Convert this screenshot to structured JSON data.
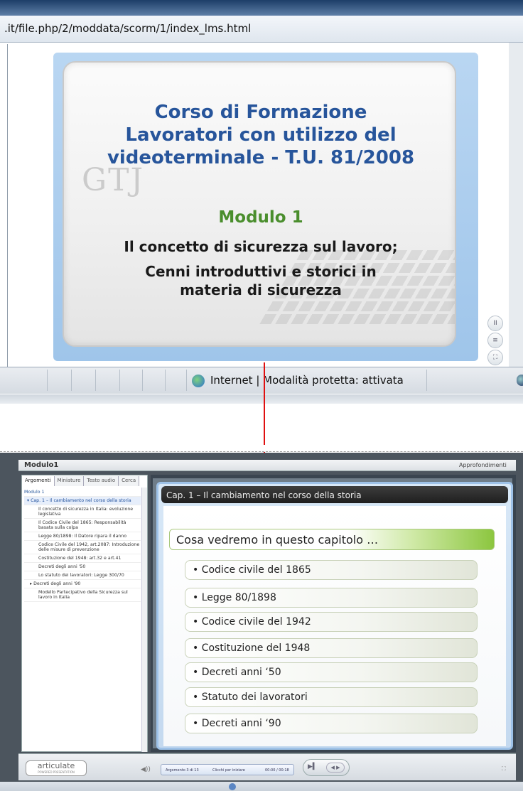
{
  "browser": {
    "address": ".it/file.php/2/moddata/scorm/1/index_lms.html",
    "status_text": "Internet | Modalità protetta: attivata"
  },
  "title_slide": {
    "title_lines": [
      "Corso di Formazione",
      "Lavoratori con utilizzo del",
      "videoterminale - T.U. 81/2008"
    ],
    "logo_text": "GTJ",
    "module": "Modulo 1",
    "subtitle_lines": [
      "Il concetto di sicurezza sul lavoro;",
      "Cenni introduttivi e storici in",
      "materia di sicurezza"
    ],
    "controls": [
      "II",
      "≡",
      "⛶"
    ]
  },
  "player": {
    "title": "Modulo1",
    "resources_link": "Approfondimenti",
    "tabs": [
      "Argomenti",
      "Miniature",
      "Testo audio",
      "Cerca"
    ],
    "outline": [
      {
        "label": "Modulo 1",
        "level": "lvl0"
      },
      {
        "label": "▾ Cap. 1 – Il cambiamento nel corso della storia",
        "level": "sel"
      },
      {
        "label": "Il concetto di sicurezza in Italia: evoluzione legislativa",
        "level": "lvl1"
      },
      {
        "label": "Il Codice Civile del 1865: Responsabilità basata sulla colpa",
        "level": "lvl1"
      },
      {
        "label": "Legge 80/1898: Il Datore ripara il danno",
        "level": "lvl1"
      },
      {
        "label": "Codice Civile del 1942, art.2087: Introduzione delle misure di prevenzione",
        "level": "lvl1"
      },
      {
        "label": "Costituzione del 1948: art.32 e art.41",
        "level": "lvl1"
      },
      {
        "label": "Decreti degli anni '50",
        "level": "lvl1"
      },
      {
        "label": "Lo statuto dei lavoratori: Legge 300/70",
        "level": "lvl1"
      },
      {
        "label": "▸ Decreti degli anni '90",
        "level": "lvl1b"
      },
      {
        "label": "Modello Partecipativo della Sicurezza sul lavoro in Italia",
        "level": "lvl1"
      }
    ],
    "chapter_title": "Cap. 1 – Il cambiamento nel corso della storia",
    "heading": "Cosa vedremo in questo capitolo …",
    "bullets": [
      "• Codice civile del 1865",
      "• Legge 80/1898",
      "• Codice civile del 1942",
      "• Costituzione del 1948",
      "• Decreti anni ‘50",
      "• Statuto dei lavoratori",
      "• Decreti anni ‘90"
    ],
    "logo_text": "articulate",
    "logo_sub": "POWERED PRESENTATION",
    "info": {
      "slide_counter": "Argomento 3 di 13",
      "status": "Clicchi per iniziare",
      "time": "00:00 / 00:18"
    }
  }
}
